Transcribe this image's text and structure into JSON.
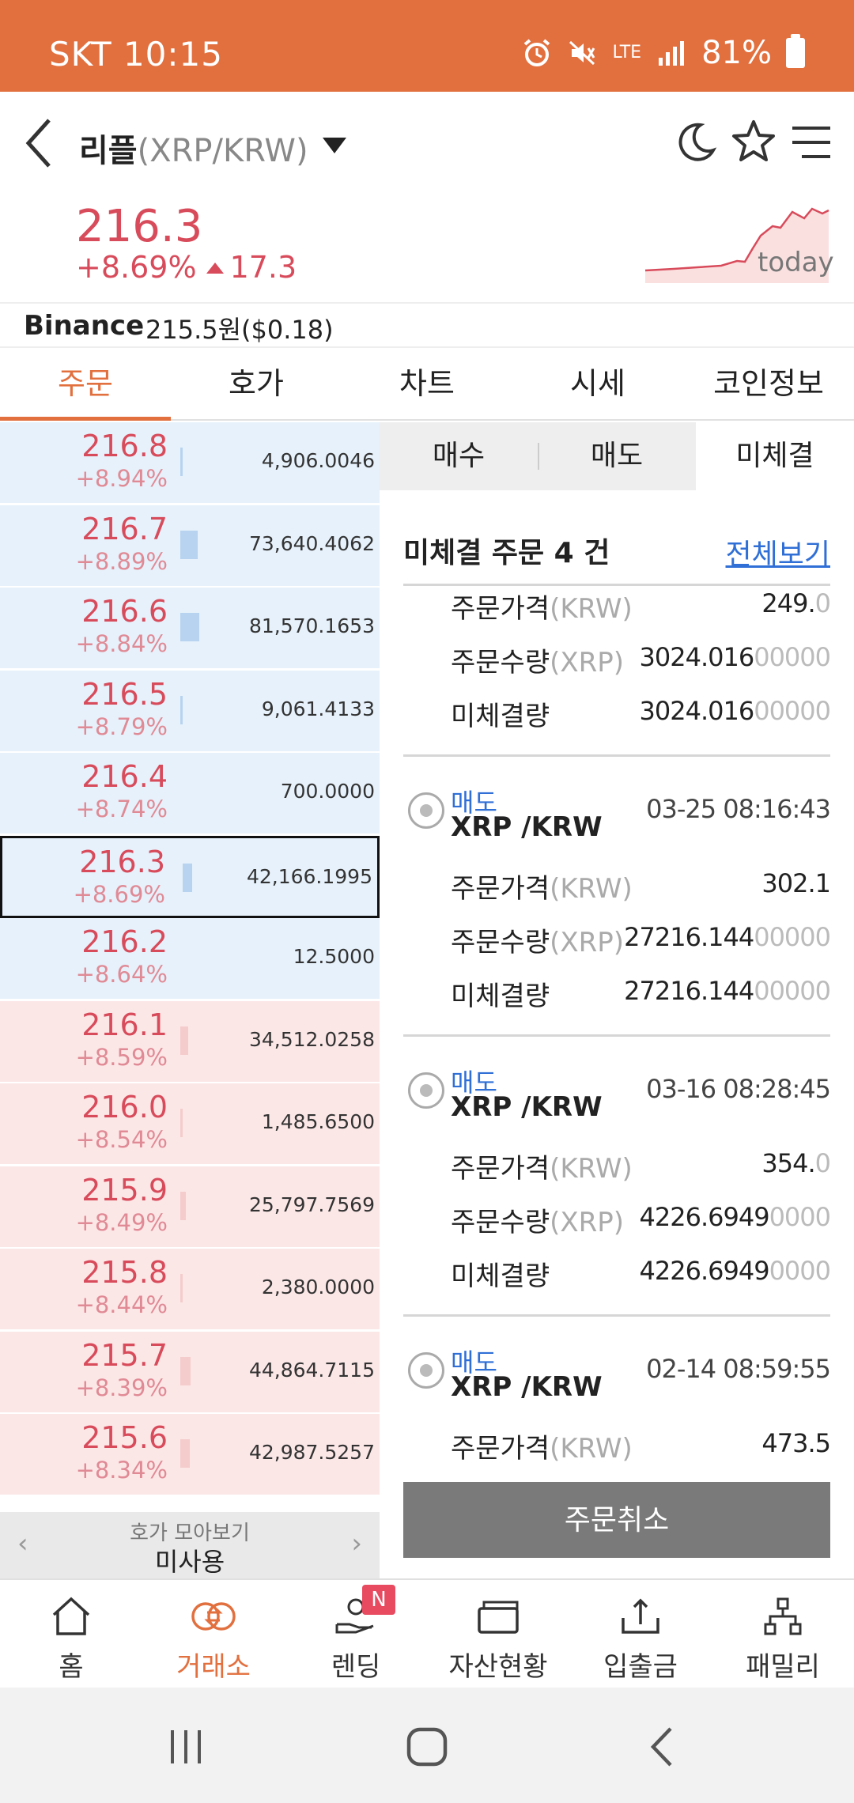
{
  "status_bar": {
    "carrier_time": "SKT 10:15",
    "network": "LTE",
    "battery": "81%"
  },
  "header": {
    "coin_name": "리플",
    "pair": "(XRP/KRW)"
  },
  "price": {
    "current": "216.3",
    "change_pct": "+8.69%",
    "change_amt": "17.3",
    "sparkline_label": "today"
  },
  "binance": {
    "label": "Binance",
    "value": "215.5원($0.18)"
  },
  "tabs": [
    "주문",
    "호가",
    "차트",
    "시세",
    "코인정보"
  ],
  "orderbook": {
    "rows": [
      {
        "price": "216.8",
        "pct": "+8.94%",
        "volume": "4,906.0046",
        "side": "ask",
        "bar": 0.07
      },
      {
        "price": "216.7",
        "pct": "+8.89%",
        "volume": "73,640.4062",
        "side": "ask",
        "bar": 0.9
      },
      {
        "price": "216.6",
        "pct": "+8.84%",
        "volume": "81,570.1653",
        "side": "ask",
        "bar": 1.0
      },
      {
        "price": "216.5",
        "pct": "+8.79%",
        "volume": "9,061.4133",
        "side": "ask",
        "bar": 0.12
      },
      {
        "price": "216.4",
        "pct": "+8.74%",
        "volume": "700.0000",
        "side": "ask",
        "bar": 0.0
      },
      {
        "price": "216.3",
        "pct": "+8.69%",
        "volume": "42,166.1995",
        "side": "ask",
        "bar": 0.5,
        "current": true
      },
      {
        "price": "216.2",
        "pct": "+8.64%",
        "volume": "12.5000",
        "side": "ask",
        "bar": 0.0
      },
      {
        "price": "216.1",
        "pct": "+8.59%",
        "volume": "34,512.0258",
        "side": "bid",
        "bar": 0.4
      },
      {
        "price": "216.0",
        "pct": "+8.54%",
        "volume": "1,485.6500",
        "side": "bid",
        "bar": 0.02
      },
      {
        "price": "215.9",
        "pct": "+8.49%",
        "volume": "25,797.7569",
        "side": "bid",
        "bar": 0.3
      },
      {
        "price": "215.8",
        "pct": "+8.44%",
        "volume": "2,380.0000",
        "side": "bid",
        "bar": 0.03
      },
      {
        "price": "215.7",
        "pct": "+8.39%",
        "volume": "44,864.7115",
        "side": "bid",
        "bar": 0.55
      },
      {
        "price": "215.6",
        "pct": "+8.34%",
        "volume": "42,987.5257",
        "side": "bid",
        "bar": 0.5
      }
    ],
    "footer_label": "호가 모아보기",
    "footer_value": "미사용"
  },
  "sub_tabs": {
    "buy": "매수",
    "sell": "매도",
    "unfilled": "미체결"
  },
  "unfilled": {
    "header": "미체결 주문 4 건",
    "view_all": "전체보기",
    "labels": {
      "price": "주문가격",
      "price_unit": "(KRW)",
      "qty": "주문수량",
      "qty_unit": "(XRP)",
      "unfilled_qty": "미체결량"
    },
    "first_partial": {
      "price": "249.",
      "price_zero": "0",
      "qty": "3024.016",
      "qty_zero": "00000",
      "unfilled": "3024.016",
      "unfilled_zero": "00000"
    },
    "orders": [
      {
        "type": "매도",
        "pair": "XRP /KRW",
        "time": "03-25 08:16:43",
        "price": "302.1",
        "price_zero": "",
        "qty": "27216.144",
        "qty_zero": "00000",
        "unfilled": "27216.144",
        "unfilled_zero": "00000"
      },
      {
        "type": "매도",
        "pair": "XRP /KRW",
        "time": "03-16 08:28:45",
        "price": "354.",
        "price_zero": "0",
        "qty": "4226.6949",
        "qty_zero": "0000",
        "unfilled": "4226.6949",
        "unfilled_zero": "0000"
      },
      {
        "type": "매도",
        "pair": "XRP /KRW",
        "time": "02-14 08:59:55",
        "price": "473.5",
        "price_zero": ""
      }
    ],
    "cancel_button": "주문취소"
  },
  "bottom_nav": [
    {
      "label": "홈",
      "icon": "home-icon"
    },
    {
      "label": "거래소",
      "icon": "exchange-icon",
      "active": true
    },
    {
      "label": "렌딩",
      "icon": "lending-icon",
      "badge": "N"
    },
    {
      "label": "자산현황",
      "icon": "wallet-icon"
    },
    {
      "label": "입출금",
      "icon": "deposit-icon"
    },
    {
      "label": "패밀리",
      "icon": "family-icon"
    }
  ],
  "colors": {
    "accent": "#e2703f",
    "up": "#d84b5b",
    "link": "#2f6fd6"
  }
}
